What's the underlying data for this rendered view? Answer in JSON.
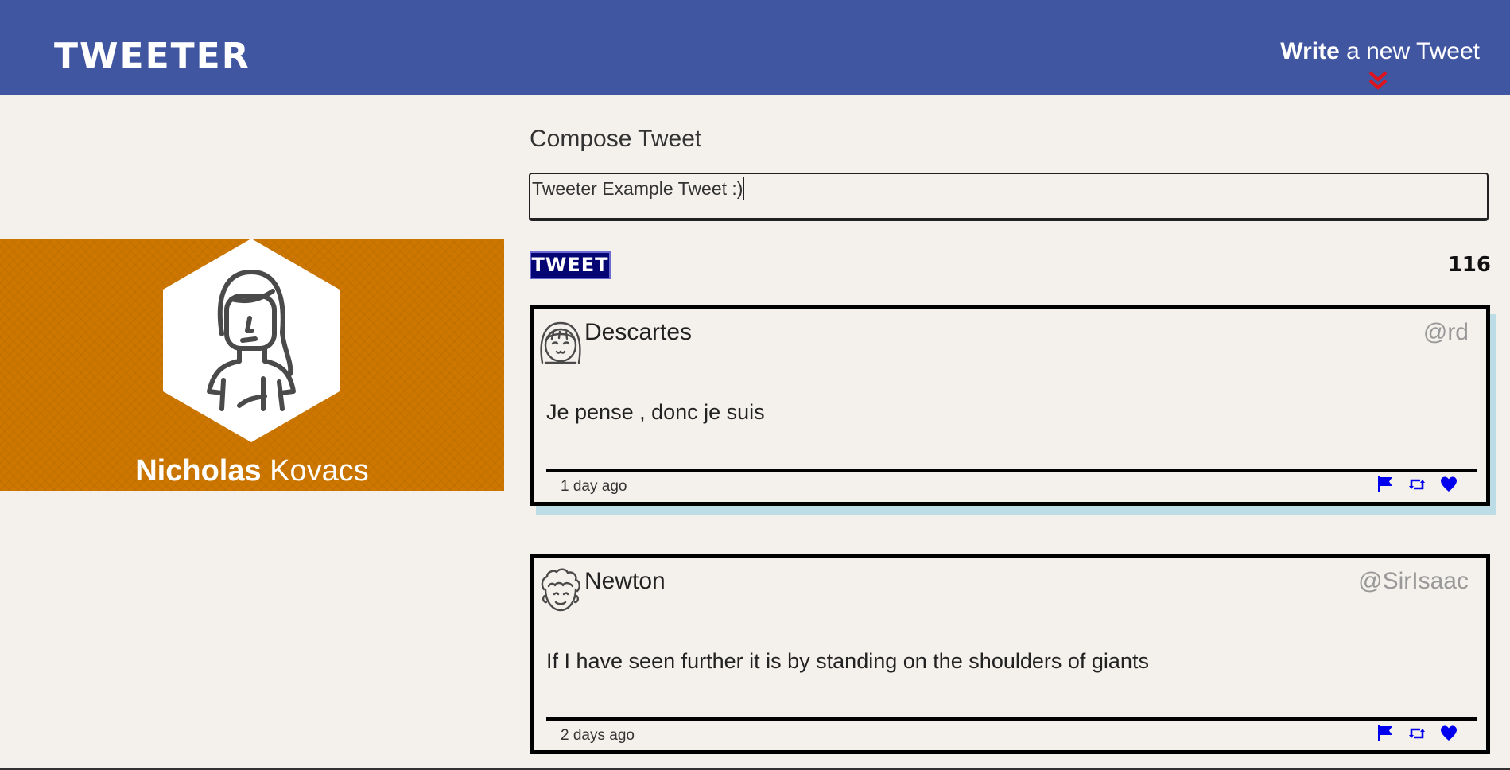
{
  "nav": {
    "brand": "TWEETER",
    "write_strong": "Write",
    "write_rest": " a new Tweet"
  },
  "profile": {
    "first_name": "Nicholas",
    "last_name": " Kovacs"
  },
  "compose": {
    "title": "Compose Tweet",
    "value": "Tweeter Example Tweet :)",
    "button_label": "TWEET",
    "counter": "116"
  },
  "tweets": [
    {
      "name": "Descartes",
      "handle": "@rd",
      "content": "Je pense , donc je suis",
      "time": "1 day ago",
      "avatar_icon": "girl-bangs-avatar-icon"
    },
    {
      "name": "Newton",
      "handle": "@SirIsaac",
      "content": "If I have seen further it is by standing on the shoulders of giants",
      "time": "2 days ago",
      "avatar_icon": "curly-hair-avatar-icon"
    }
  ],
  "colors": {
    "nav_bg": "#4056a1",
    "profile_bg": "#cd7700",
    "tweet_button_bg": "#050574",
    "action_icons": "#0000ee",
    "chevron": "#e0121b",
    "tweet_shadow": "#bddde6",
    "page_bg": "#f4f1ec"
  },
  "icons": {
    "nav_chevron": "double-chevron-down-icon",
    "actions": [
      "flag-icon",
      "retweet-icon",
      "heart-icon"
    ]
  }
}
